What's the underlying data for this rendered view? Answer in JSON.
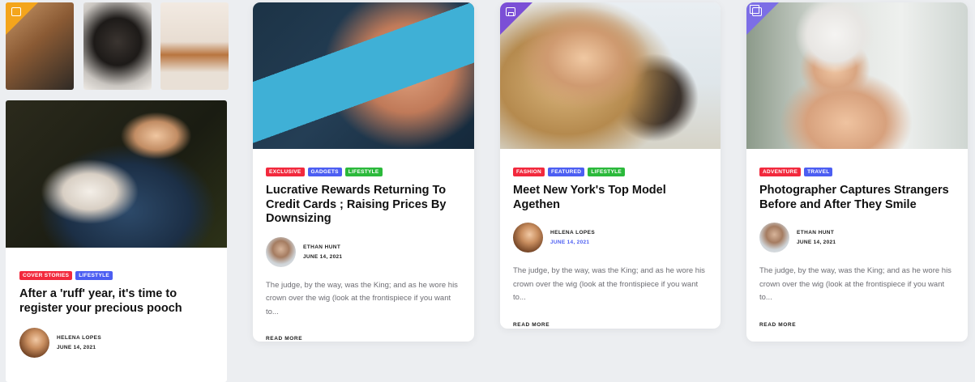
{
  "left_column": {
    "lead_card": {
      "tags": [
        {
          "label": "COVER STORIES",
          "color": "#f2293d"
        },
        {
          "label": "LIFESTYLE",
          "color": "#4c5ef2"
        }
      ],
      "title": "After a 'ruff' year, it's time to register your precious pooch",
      "author": {
        "name": "HELENA LOPES",
        "date": "JUNE 14, 2021"
      }
    }
  },
  "cards": [
    {
      "tags": [
        {
          "label": "EXCLUSIVE",
          "color": "#f2293d"
        },
        {
          "label": "GADGETS",
          "color": "#4c5ef2"
        },
        {
          "label": "LIFESTYLE",
          "color": "#2bb93b"
        }
      ],
      "title": "Lucrative Rewards Returning To Credit Cards ; Raising Prices By Downsizing",
      "author": {
        "name": "ETHAN HUNT",
        "date": "JUNE 14, 2021"
      },
      "excerpt": "The judge, by the way, was the King; and as he wore his crown over the wig (look at the frontispiece if you want to...",
      "read_more": "READ MORE"
    },
    {
      "tags": [
        {
          "label": "FASHION",
          "color": "#f2293d"
        },
        {
          "label": "FEATURED",
          "color": "#4c5ef2"
        },
        {
          "label": "LIFESTYLE",
          "color": "#2bb93b"
        }
      ],
      "title": "Meet New York's Top Model Agethen",
      "author": {
        "name": "HELENA LOPES",
        "date": "JUNE 14, 2021"
      },
      "excerpt": "The judge, by the way, was the King; and as he wore his crown over the wig (look at the frontispiece if you want to...",
      "read_more": "READ MORE"
    },
    {
      "tags": [
        {
          "label": "ADVENTURE",
          "color": "#f2293d"
        },
        {
          "label": "TRAVEL",
          "color": "#4c5ef2"
        }
      ],
      "title": "Photographer Captures Strangers Before and After They Smile",
      "author": {
        "name": "ETHAN HUNT",
        "date": "JUNE 14, 2021"
      },
      "excerpt": "The judge, by the way, was the King; and as he wore his crown over the wig (look at the frontispiece if you want to...",
      "read_more": "READ MORE"
    }
  ],
  "icons": {
    "thumb_1_corner": "image-icon",
    "card_2_corner": "bookmark-icon",
    "card_3_corner": "gallery-icon"
  },
  "colors": {
    "accent_red": "#f2293d",
    "accent_blue": "#4c5ef2",
    "accent_green": "#2bb93b",
    "corner_orange": "#f4a51c",
    "corner_purple": "#7b4fd6"
  }
}
